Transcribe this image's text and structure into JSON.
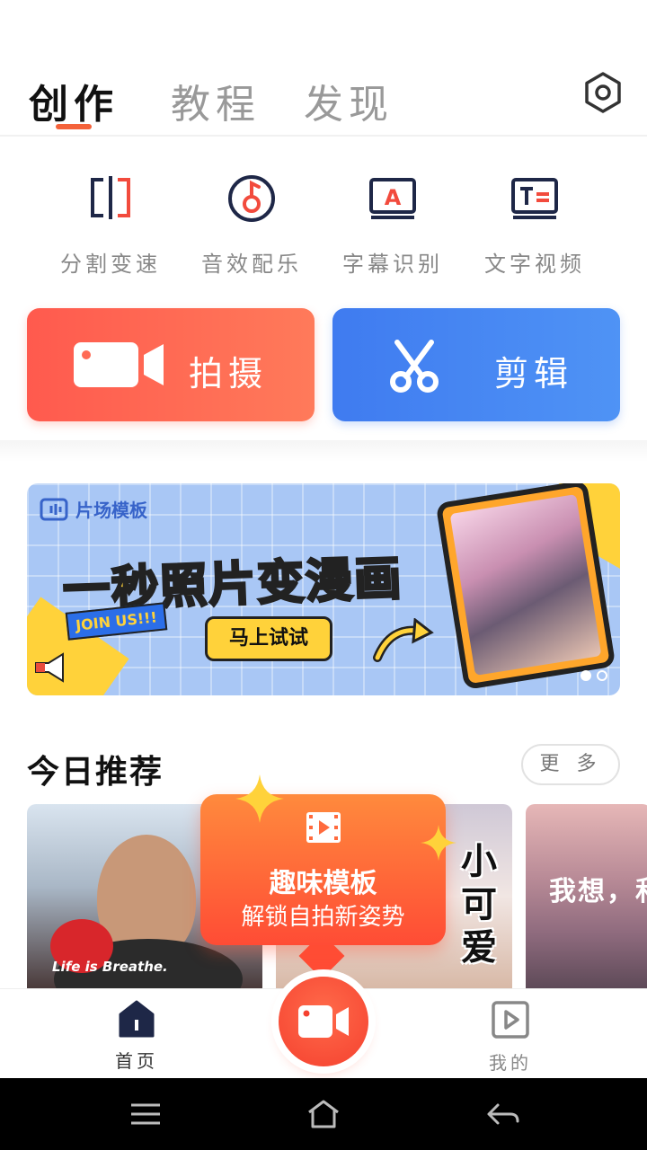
{
  "header": {
    "tabs": [
      {
        "label": "创作",
        "active": true
      },
      {
        "label": "教程",
        "active": false
      },
      {
        "label": "发现",
        "active": false
      }
    ],
    "settings_icon": "settings-hexagon-icon",
    "accent_color": "#f4623a"
  },
  "tools": [
    {
      "label": "分割变速",
      "icon": "split-icon"
    },
    {
      "label": "音效配乐",
      "icon": "music-note-icon"
    },
    {
      "label": "字幕识别",
      "icon": "subtitle-a-icon"
    },
    {
      "label": "文字视频",
      "icon": "text-video-icon"
    }
  ],
  "actions": {
    "shoot": {
      "label": "拍摄",
      "icon": "camera-icon",
      "color": "#ff5a4e"
    },
    "edit": {
      "label": "剪辑",
      "icon": "scissors-icon",
      "color": "#3f7bf0"
    }
  },
  "banner": {
    "brand": "片场模板",
    "title": "一秒照片变漫画",
    "cta": "马上试试",
    "badge": "JOIN US!!!",
    "page_count": 2,
    "active_page": 1
  },
  "recommend": {
    "title": "今日推荐",
    "more_label": "更 多",
    "cards": [
      {
        "caption": "Life is Breathe."
      },
      {
        "title": "小可爱"
      },
      {
        "title": "我想，和"
      }
    ]
  },
  "promo": {
    "title": "趣味模板",
    "subtitle": "解锁自拍新姿势",
    "icon": "film-icon"
  },
  "bottom_nav": {
    "home": {
      "label": "首页",
      "icon": "home-icon"
    },
    "record": {
      "icon": "camera-icon"
    },
    "mine": {
      "label": "我的",
      "icon": "play-box-icon"
    }
  },
  "system_bar": {
    "menu_icon": "menu-icon",
    "home_icon": "home-outline-icon",
    "back_icon": "back-icon"
  }
}
